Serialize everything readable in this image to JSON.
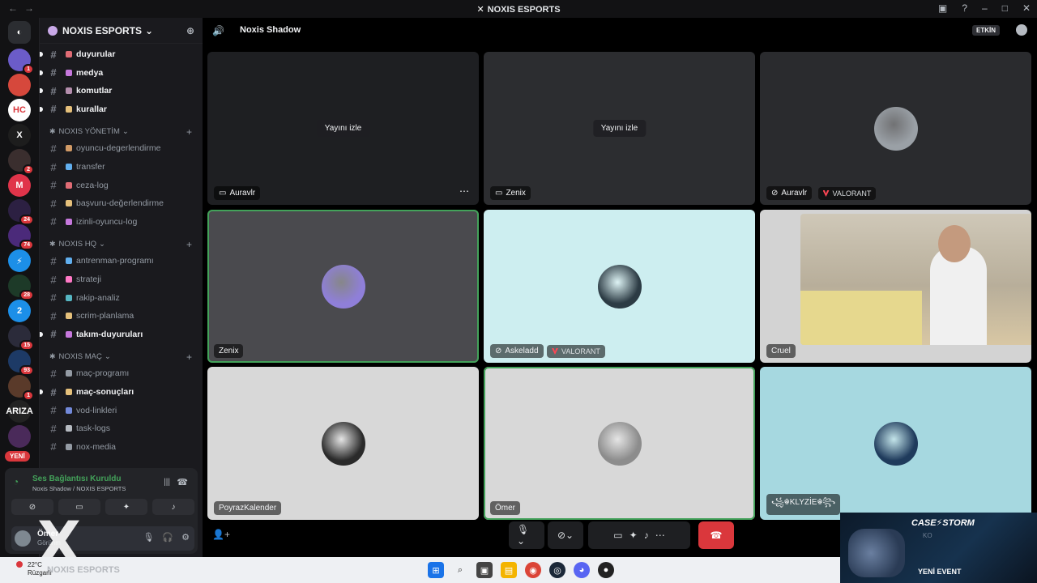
{
  "window": {
    "title": "NOXIS ESPORTS"
  },
  "guilds": [
    {
      "color": "#6b5cc9",
      "text": "",
      "badge": "1"
    },
    {
      "color": "#d6483c",
      "text": "",
      "badge": ""
    },
    {
      "color": "#ffffff",
      "text": "HC",
      "badge": ""
    },
    {
      "color": "#1d1d1d",
      "text": "X",
      "badge": ""
    },
    {
      "color": "#3a2e2e",
      "text": "",
      "badge": "2"
    },
    {
      "color": "#e0344a",
      "text": "M",
      "badge": ""
    },
    {
      "color": "#2c2042",
      "text": "",
      "badge": "24"
    },
    {
      "color": "#4b2a7a",
      "text": "",
      "badge": "74"
    },
    {
      "color": "#1c8fe8",
      "text": "⚡",
      "badge": ""
    },
    {
      "color": "#1d3a28",
      "text": "",
      "badge": "28"
    },
    {
      "color": "#1c8fe8",
      "text": "2",
      "badge": ""
    },
    {
      "color": "#2b2b3a",
      "text": "",
      "badge": "15"
    },
    {
      "color": "#1d3a66",
      "text": "",
      "badge": "93"
    },
    {
      "color": "#5a3a2a",
      "text": "",
      "badge": "1"
    },
    {
      "color": "#222222",
      "text": "ARIZA",
      "badge": ""
    },
    {
      "color": "#4a2a5a",
      "text": "",
      "badge": ""
    }
  ],
  "yeni_label": "YENİ",
  "server": {
    "name": "NOXIS ESPORTS"
  },
  "channels": [
    {
      "name": "duyurular",
      "emoji_color": "#e06c75",
      "unread": true
    },
    {
      "name": "medya",
      "emoji_color": "#c678dd",
      "unread": true
    },
    {
      "name": "komutlar",
      "emoji_color": "#b48ead",
      "unread": true
    },
    {
      "name": "kurallar",
      "emoji_color": "#e5c07b",
      "unread": true
    }
  ],
  "categories": [
    {
      "name": "NOXIS YÖNETİM",
      "channels": [
        {
          "name": "oyuncu-degerlendirme",
          "emoji_color": "#d19a66"
        },
        {
          "name": "transfer",
          "emoji_color": "#61afef"
        },
        {
          "name": "ceza-log",
          "emoji_color": "#e06c75"
        },
        {
          "name": "başvuru-değerlendirme",
          "emoji_color": "#e5c07b"
        },
        {
          "name": "izinli-oyuncu-log",
          "emoji_color": "#c678dd"
        }
      ]
    },
    {
      "name": "NOXIS HQ",
      "channels": [
        {
          "name": "antrenman-programı",
          "emoji_color": "#61afef"
        },
        {
          "name": "strateji",
          "emoji_color": "#ff79c6"
        },
        {
          "name": "rakip-analiz",
          "emoji_color": "#56b6c2"
        },
        {
          "name": "scrim-planlama",
          "emoji_color": "#e5c07b"
        },
        {
          "name": "takım-duyuruları",
          "emoji_color": "#c678dd",
          "unread": true
        }
      ]
    },
    {
      "name": "NOXIS MAÇ",
      "channels": [
        {
          "name": "maç-programı",
          "emoji_color": "#949ba4"
        },
        {
          "name": "maç-sonuçları",
          "emoji_color": "#e5c07b",
          "unread": true
        },
        {
          "name": "vod-linkleri",
          "emoji_color": "#7289da"
        },
        {
          "name": "task-logs",
          "emoji_color": "#b5bac1"
        },
        {
          "name": "nox-media",
          "emoji_color": "#949ba4"
        }
      ]
    }
  ],
  "voice_panel": {
    "status": "Ses Bağlantısı Kuruldu",
    "location": "Noxis Shadow / NOXIS ESPORTS",
    "user_name": "Ömer",
    "user_status": "Görünm"
  },
  "call": {
    "channel_name": "Noxis Shadow",
    "activity_label": "ETKİN",
    "watch_label": "Yayını izle",
    "tiles": [
      {
        "name": "Auravlr",
        "type": "stream",
        "bg": "#1e1f22",
        "watch": true,
        "more": true,
        "tag": ""
      },
      {
        "name": "Zenix",
        "type": "stream",
        "bg": "#2c2d30",
        "watch": true,
        "more": false,
        "tag": ""
      },
      {
        "name": "Auravlr",
        "type": "avatar",
        "bg": "#2a2b2e",
        "avatar_color": "#9aa0a6",
        "tag": "VALORANT"
      },
      {
        "name": "Zenix",
        "type": "avatar",
        "bg": "#4a4a4e",
        "avatar_color": "#8f7fd9",
        "tag": "",
        "speaking": true
      },
      {
        "name": "Askeladd",
        "type": "avatar",
        "bg": "#cdeef0",
        "avatar_color": "#2c3b44",
        "tag": "VALORANT"
      },
      {
        "name": "Cruel",
        "type": "camera",
        "bg": "#d3d3d3",
        "tag": ""
      },
      {
        "name": "PoyrazKalender",
        "type": "avatar",
        "bg": "#d8d8d8",
        "avatar_color": "#2a2a2a",
        "tag": ""
      },
      {
        "name": "Ömer",
        "type": "avatar",
        "bg": "#d8d8d8",
        "avatar_color": "#8c8c8c",
        "tag": "",
        "speaking": true
      },
      {
        "name": "꧁☬KLYZİE☬꧂",
        "type": "avatar",
        "bg": "#a6d8e0",
        "avatar_color": "#1f3b5c",
        "tag": ""
      }
    ]
  },
  "taskbar": {
    "temperature": "22°C",
    "weather": "Rüzgarlı",
    "watermark": "NOXIS ESPORTS"
  },
  "promo": {
    "brand": "CASE⚡STORM",
    "sub": "KO",
    "cta": "YENİ EVENT"
  }
}
